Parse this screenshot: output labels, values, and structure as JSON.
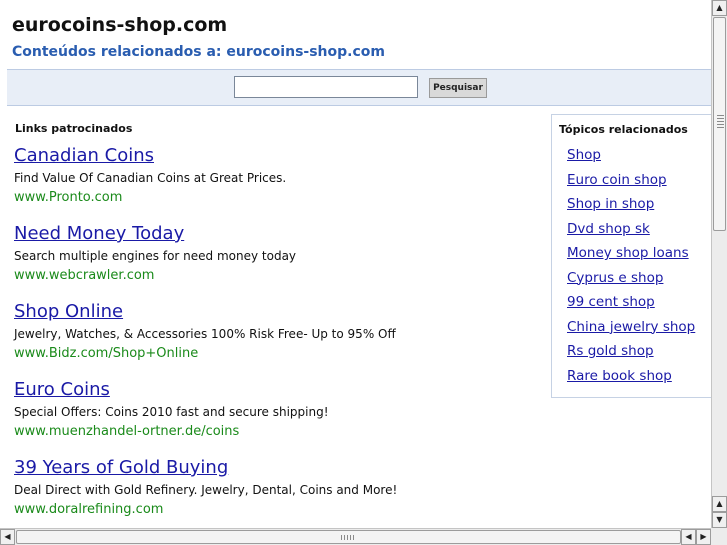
{
  "header": {
    "site_title": "eurocoins-shop.com",
    "subtitle": "Conteúdos relacionados a: eurocoins-shop.com"
  },
  "search": {
    "input_value": "",
    "button_label": "Pesquisar"
  },
  "sponsored": {
    "heading": "Links patrocinados",
    "ads": [
      {
        "title": "Canadian Coins",
        "desc": "Find Value Of Canadian Coins at Great Prices.",
        "url": "www.Pronto.com"
      },
      {
        "title": "Need Money Today",
        "desc": "Search multiple engines for need money today",
        "url": "www.webcrawler.com"
      },
      {
        "title": "Shop Online",
        "desc": "Jewelry, Watches, & Accessories 100% Risk Free- Up to 95% Off",
        "url": "www.Bidz.com/Shop+Online"
      },
      {
        "title": "Euro Coins",
        "desc": "Special Offers: Coins 2010 fast and secure shipping!",
        "url": "www.muenzhandel-ortner.de/coins"
      },
      {
        "title": "39 Years of Gold Buying",
        "desc": "Deal Direct with Gold Refinery. Jewelry, Dental, Coins and More!",
        "url": "www.doralrefining.com"
      }
    ]
  },
  "related": {
    "heading": "Tópicos relacionados",
    "items": [
      "Shop",
      "Euro coin shop",
      "Shop in shop",
      "Dvd shop sk",
      "Money shop loans",
      "Cyprus e shop",
      "99 cent shop",
      "China jewelry shop",
      "Rs gold shop",
      "Rare book shop"
    ]
  },
  "scrollbars": {
    "up_arrow": "▲",
    "down_arrow": "▼",
    "left_arrow": "◀",
    "right_arrow": "▶"
  },
  "colors": {
    "link": "#1a1aa6",
    "url_green": "#1a8a1a",
    "subtitle_blue": "#2a5db0",
    "search_bar_bg": "#e8eef7"
  }
}
